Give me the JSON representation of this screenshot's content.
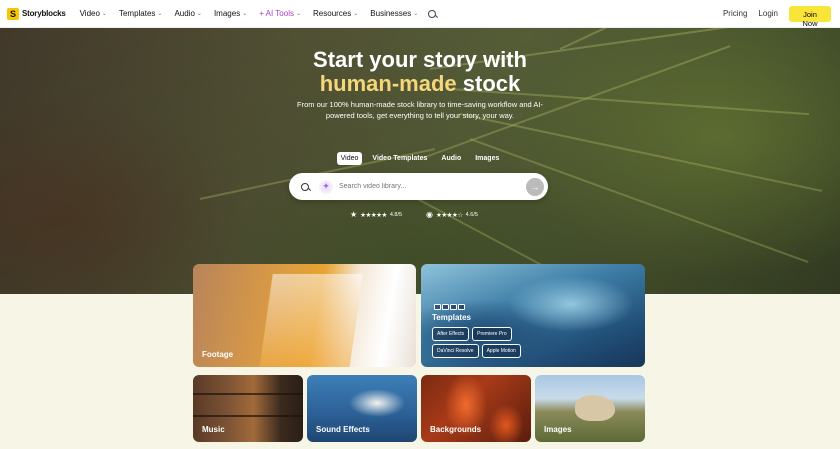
{
  "brand": {
    "name": "Storyblocks",
    "accent": "#f9e43a"
  },
  "nav": {
    "items": [
      {
        "label": "Video",
        "has_dropdown": true
      },
      {
        "label": "Templates",
        "has_dropdown": true
      },
      {
        "label": "Audio",
        "has_dropdown": true
      },
      {
        "label": "Images",
        "has_dropdown": true
      },
      {
        "label": "+ AI Tools",
        "has_dropdown": true
      },
      {
        "label": "Resources",
        "has_dropdown": true
      },
      {
        "label": "Businesses",
        "has_dropdown": true
      }
    ],
    "pricing": "Pricing",
    "login": "Login",
    "join": "Join Now"
  },
  "hero": {
    "title_line1": "Start your story with",
    "title_highlight": "human-made",
    "title_rest": "stock",
    "subtitle": "From our 100% human-made stock library to time-saving workflow and AI-powered tools, get everything to tell your story, your way.",
    "tabs": [
      "Video",
      "Video Templates",
      "Audio",
      "Images"
    ],
    "active_tab": "Video",
    "search_placeholder": "Search video library...",
    "ratings": [
      {
        "source_icon": "trustpilot-star-icon",
        "score": "4.8/5"
      },
      {
        "source_icon": "g2-icon",
        "score": "4.6/5"
      }
    ]
  },
  "cards": {
    "footage": "Footage",
    "templates": {
      "title": "Templates",
      "chips": [
        "After Effects",
        "Premiere Pro",
        "DaVinci Resolve",
        "Apple Motion"
      ]
    },
    "music": "Music",
    "sound_effects": "Sound Effects",
    "backgrounds": "Backgrounds",
    "images": "Images"
  }
}
